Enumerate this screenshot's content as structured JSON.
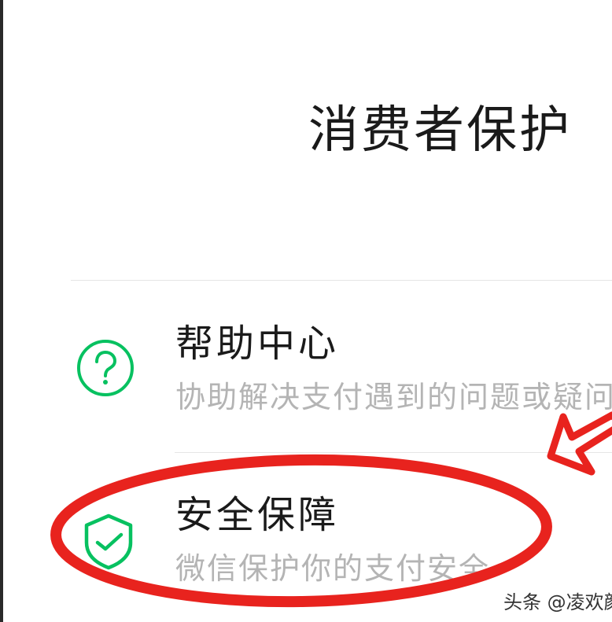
{
  "header": {
    "title": "消费者保护"
  },
  "menu": {
    "items": [
      {
        "title": "帮助中心",
        "subtitle": "协助解决支付遇到的问题或疑问",
        "icon": "question-circle-icon",
        "icon_color": "#07C160"
      },
      {
        "title": "安全保障",
        "subtitle": "微信保护你的支付安全",
        "icon": "shield-check-icon",
        "icon_color": "#07C160"
      }
    ]
  },
  "annotation": {
    "highlight_color": "#E8231E",
    "shapes": [
      "ellipse-highlight",
      "arrow"
    ]
  },
  "watermark": {
    "text": "头条 @凌欢颜"
  }
}
